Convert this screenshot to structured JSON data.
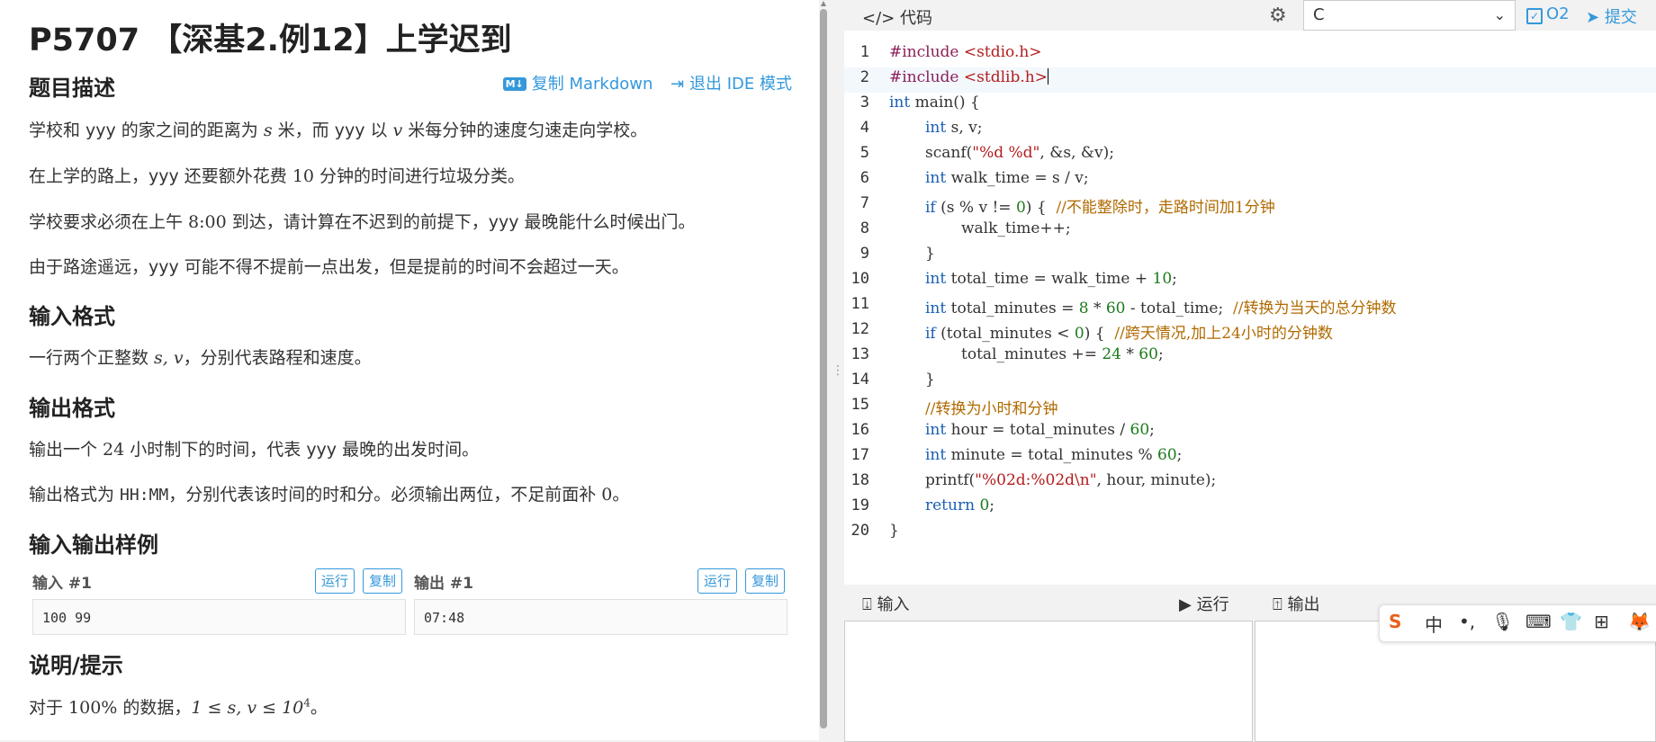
{
  "problem": {
    "title": "P5707 【深基2.例12】上学迟到",
    "actions": {
      "copy_markdown": "复制 Markdown",
      "exit_ide": "退出 IDE 模式",
      "md_badge": "M↓"
    },
    "section_desc": "题目描述",
    "desc_p1_a": "学校和 yyy 的家之间的距离为 ",
    "desc_p1_s": "s",
    "desc_p1_b": " 米，而 yyy 以 ",
    "desc_p1_v": "v",
    "desc_p1_c": " 米每分钟的速度匀速走向学校。",
    "desc_p2_a": "在上学的路上，yyy 还要额外花费 ",
    "desc_p2_n": "10",
    "desc_p2_b": " 分钟的时间进行垃圾分类。",
    "desc_p3_a": "学校要求必须在上午 ",
    "desc_p3_t": "8:00",
    "desc_p3_b": " 到达，请计算在不迟到的前提下，yyy 最晚能什么时候出门。",
    "desc_p4": "由于路途遥远，yyy 可能不得不提前一点出发，但是提前的时间不会超过一天。",
    "section_input": "输入格式",
    "input_a": "一行两个正整数 ",
    "input_m": "s, v",
    "input_b": "，分别代表路程和速度。",
    "section_output": "输出格式",
    "output_p1_a": "输出一个 ",
    "output_p1_n": "24",
    "output_p1_b": " 小时制下的时间，代表 yyy 最晚的出发时间。",
    "output_p2_a": "输出格式为 ",
    "output_p2_code": "HH:MM",
    "output_p2_b": "，分别代表该时间的时和分。必须输出两位，不足前面补 ",
    "output_p2_n": "0",
    "output_p2_c": "。",
    "section_samples": "输入输出样例",
    "sample_in_label": "输入 #1",
    "sample_out_label": "输出 #1",
    "run_label": "运行",
    "copy_label": "复制",
    "sample_in_value": "100 99",
    "sample_out_value": "07:48",
    "section_hint": "说明/提示",
    "hint_a": "对于 ",
    "hint_pct": "100%",
    "hint_b": " 的数据，",
    "hint_math": "1 ≤ s, v ≤ 10",
    "hint_sup": "4",
    "hint_c": "。"
  },
  "ide": {
    "code_tab": "代码",
    "language": "C",
    "o2_label": "O2",
    "submit_label": "提交",
    "line_numbers": [
      "1",
      "2",
      "3",
      "4",
      "5",
      "6",
      "7",
      "8",
      "9",
      "10",
      "11",
      "12",
      "13",
      "14",
      "15",
      "16",
      "17",
      "18",
      "19",
      "20"
    ],
    "code": {
      "l1a": "#include ",
      "l1b": "<stdio.h>",
      "l2a": "#include ",
      "l2b": "<stdlib.h>",
      "l3a": "int",
      "l3b": " main() {",
      "l4a": "int",
      "l4b": " s, v;",
      "l5a": "scanf(",
      "l5b": "\"%d %d\"",
      "l5c": ", &s, &v);",
      "l6a": "int",
      "l6b": " walk_time = s / v;",
      "l7a": "if",
      "l7b": " (s % v != ",
      "l7c": "0",
      "l7d": ") {  ",
      "l7e": "//不能整除时，走路时间加1分钟",
      "l8": "walk_time++;",
      "l9": "}",
      "l10a": "int",
      "l10b": " total_time = walk_time + ",
      "l10c": "10",
      "l10d": ";",
      "l11a": "int",
      "l11b": " total_minutes = ",
      "l11c": "8",
      "l11d": " * ",
      "l11e": "60",
      "l11f": " - total_time;  ",
      "l11g": "//转换为当天的总分钟数",
      "l12a": "if",
      "l12b": " (total_minutes < ",
      "l12c": "0",
      "l12d": ") {  ",
      "l12e": "//跨天情况,加上24小时的分钟数",
      "l13a": "total_minutes += ",
      "l13b": "24",
      "l13c": " * ",
      "l13d": "60",
      "l13e": ";",
      "l14": "}",
      "l15": "//转换为小时和分钟",
      "l16a": "int",
      "l16b": " hour = total_minutes / ",
      "l16c": "60",
      "l16d": ";",
      "l17a": "int",
      "l17b": " minute = total_minutes % ",
      "l17c": "60",
      "l17d": ";",
      "l18a": "printf(",
      "l18b": "\"%02d:%02d\\n\"",
      "l18c": ", hour, minute);",
      "l19a": "return",
      "l19b": " ",
      "l19c": "0",
      "l19d": ";",
      "l20": "}"
    },
    "io": {
      "input_label": "输入",
      "run_label": "运行",
      "output_label": "输出"
    }
  },
  "ime": {
    "zh": "中"
  }
}
